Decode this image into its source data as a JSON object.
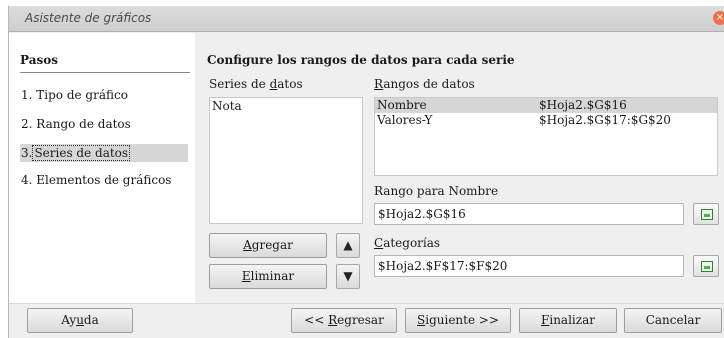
{
  "window": {
    "title": "Asistente de gráficos",
    "close_glyph": "×"
  },
  "sidebar": {
    "heading": "Pasos",
    "steps": [
      {
        "label": "1. Tipo de gráfico"
      },
      {
        "label": "2. Rango de datos"
      },
      {
        "label": "3. Series de datos",
        "num": "3.",
        "name": "Series de datos"
      },
      {
        "label": "4. Elementos de gráficos"
      }
    ]
  },
  "main": {
    "heading": "Configure los rangos de datos para cada serie",
    "series_label": {
      "pre": "Series de ",
      "ul": "d",
      "post": "atos"
    },
    "series": [
      "Nota"
    ],
    "ranges_label": {
      "ul": "R",
      "post": "angos de datos"
    },
    "ranges": [
      {
        "role": "Nombre",
        "range": "$Hoja2.$G$16"
      },
      {
        "role": "Valores-Y",
        "range": "$Hoja2.$G$17:$G$20"
      }
    ],
    "name_range_label": "Rango para Nombre",
    "name_range_value": "$Hoja2.$G$16",
    "categories_label": {
      "ul": "C",
      "post": "ategorías"
    },
    "categories_value": "$Hoja2.$F$17:$F$20",
    "add_button": {
      "ul": "A",
      "post": "gregar"
    },
    "remove_button": {
      "ul": "E",
      "post": "liminar"
    },
    "up_glyph": "▲",
    "down_glyph": "▼"
  },
  "footer": {
    "help": {
      "pre": "Ay",
      "ul": "u",
      "post": "da"
    },
    "back": {
      "pre": "<< ",
      "ul": "R",
      "post": "egresar"
    },
    "next": {
      "ul": "S",
      "post": "iguiente >>"
    },
    "finish": {
      "ul": "F",
      "post": "inalizar"
    },
    "cancel": "Cancelar"
  },
  "icons": {
    "shrink": "shrink-range-icon"
  }
}
